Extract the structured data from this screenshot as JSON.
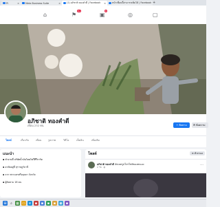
{
  "browser": {
    "tabs": [
      {
        "label": "Pi",
        "active": false
      },
      {
        "label": "Meta Business Suite",
        "active": false
      },
      {
        "label": "(1) อภิชาติ ทองคำดี | Facebook",
        "active": true
      },
      {
        "label": "หน้าเพื่อนนี้สามารถเพิ่มได้ | Facebook",
        "active": false
      }
    ]
  },
  "topbar": {
    "notif_badge_1": "9+",
    "notif_badge_2": "6"
  },
  "profile": {
    "name": "อภิชาติ ทองคำดี",
    "friends_count": "เพื่อน 232 คน",
    "primary_button": "ติดตาม",
    "secondary_button": "ข้อความ"
  },
  "profile_tabs": [
    "โพสต์",
    "เกี่ยวกับ",
    "เพื่อน",
    "รูปภาพ",
    "วิดีโอ",
    "เช็คอิน",
    "เพิ่มเติม"
  ],
  "intro": {
    "title": "แนะนำ",
    "lines": [
      "ทำงานที่ บริษัทน้ำมันไทยโพวีทีรีการ์ด",
      "อาศัยอยู่ที่ สุราษฎร์ธานี",
      "จาก พระนครศรีอยุธยา จังหวัด",
      "ผู้ติดตาม 18 คน"
    ]
  },
  "posts": {
    "title": "โพสต์",
    "filter_button": "ตัวกรอง",
    "post_author": "อภิชาติ ทองคำดี",
    "post_text": "อัปเดตรูปโปรไฟล์ของตนเอง",
    "post_time": "2 วัน"
  },
  "colors": {
    "fb_blue": "#1877f2",
    "badge_red": "#e41e3f"
  }
}
